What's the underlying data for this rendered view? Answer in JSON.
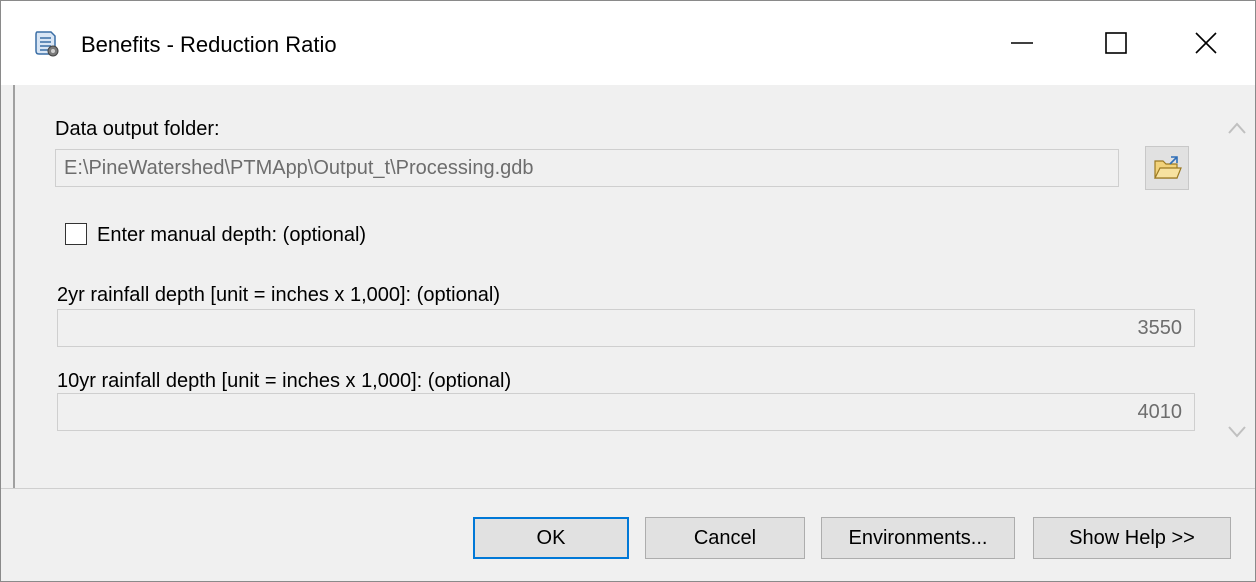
{
  "window": {
    "title": "Benefits - Reduction Ratio",
    "icon": "script-tool-icon"
  },
  "form": {
    "output_folder_label": "Data output folder:",
    "output_folder_value": "E:\\PineWatershed\\PTMApp\\Output_t\\Processing.gdb",
    "manual_depth_label": "Enter manual depth: (optional)",
    "manual_depth_checked": false,
    "rain2_label": "2yr rainfall depth [unit = inches x 1,000]: (optional)",
    "rain2_value": "3550",
    "rain10_label": "10yr rainfall depth [unit = inches x 1,000]: (optional)",
    "rain10_value": "4010"
  },
  "buttons": {
    "ok": "OK",
    "cancel": "Cancel",
    "environments": "Environments...",
    "show_help": "Show Help >>"
  },
  "colors": {
    "default_button_border": "#0078d7",
    "titlebar": "#ffffff",
    "dialog_bg": "#f0f0f0"
  }
}
